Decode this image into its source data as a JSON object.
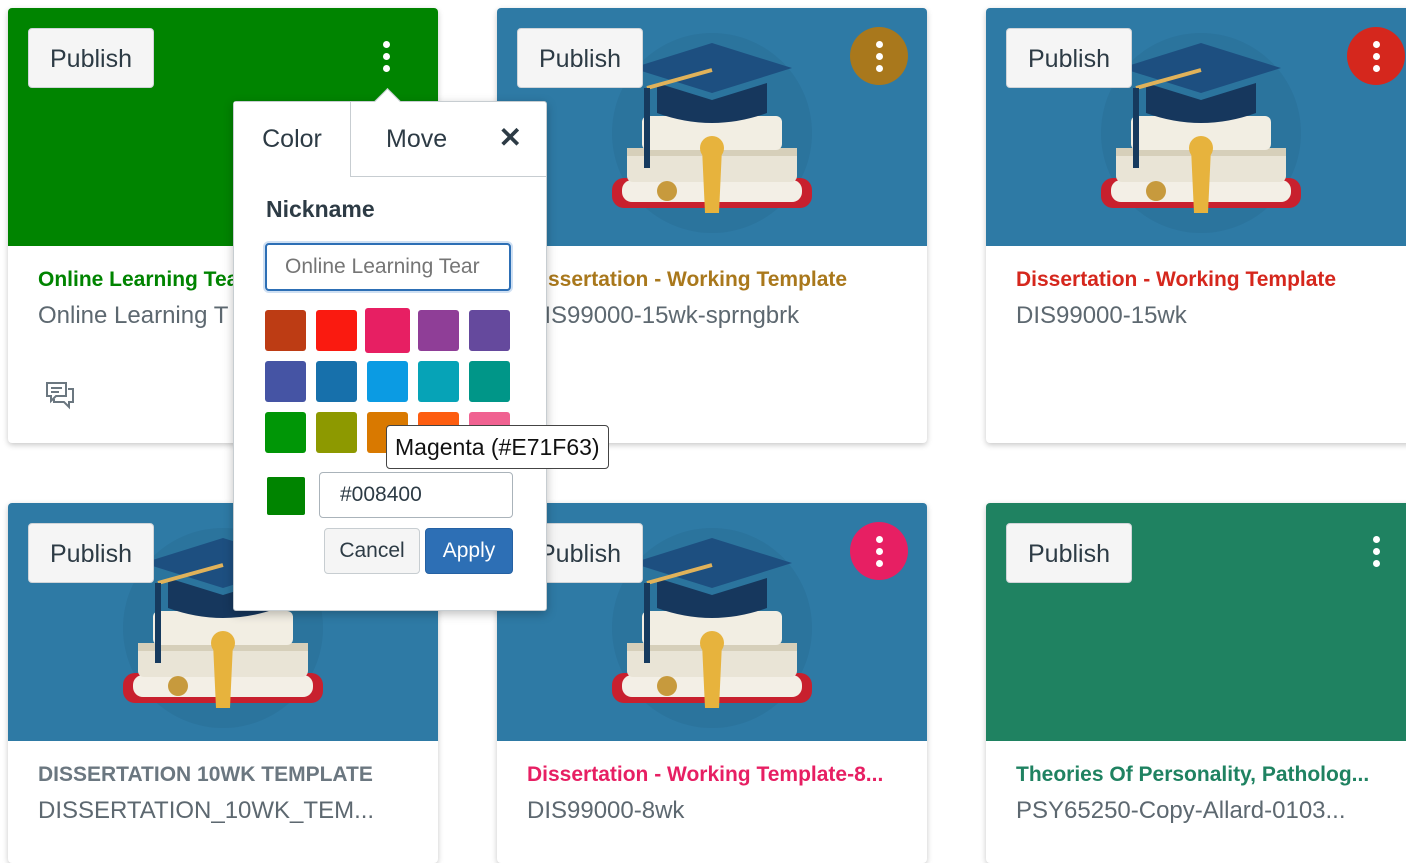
{
  "publish_label": "Publish",
  "colors": {
    "green": "#008400",
    "blue_hero": "#2e7aa5",
    "teal": "#1f8261",
    "gold_kebab": "#a9781c",
    "red_kebab": "#d5271d",
    "magenta_kebab": "#e71f63"
  },
  "cards": [
    {
      "title": "Online Learning Tea",
      "subtitle": "Online Learning T",
      "title_color": "#008400",
      "hero": "solid-green",
      "kebab": "plain",
      "icon": "discussion-icon"
    },
    {
      "title": "Dissertation - Working Template",
      "subtitle": "DIS99000-15wk-sprngbrk",
      "title_color": "#a9781c",
      "hero": "graduation-image",
      "kebab": "gold"
    },
    {
      "title": "Dissertation - Working Template",
      "subtitle": "DIS99000-15wk",
      "title_color": "#d5271d",
      "hero": "graduation-image",
      "kebab": "red"
    },
    {
      "title": "DISSERTATION 10WK TEMPLATE",
      "subtitle": "DISSERTATION_10WK_TEM...",
      "title_color": "#6b7780",
      "hero": "graduation-image",
      "kebab": "none"
    },
    {
      "title": "Dissertation - Working Template-8...",
      "subtitle": "DIS99000-8wk",
      "title_color": "#e71f63",
      "hero": "graduation-image",
      "kebab": "magenta"
    },
    {
      "title": "Theories Of Personality, Patholog...",
      "subtitle": "PSY65250-Copy-Allard-0103...",
      "title_color": "#1f8261",
      "hero": "solid-teal",
      "kebab": "plain"
    }
  ],
  "popover": {
    "tab_color": "Color",
    "tab_move": "Move",
    "close_glyph": "✕",
    "nickname_label": "Nickname",
    "nickname_placeholder": "Online Learning Tear",
    "swatches": [
      "#bd3c14",
      "#fa1a10",
      "#e71f63",
      "#8f3e97",
      "#65499d",
      "#4554a4",
      "#1770ab",
      "#0b9be3",
      "#06a3b7",
      "#009688",
      "#009606",
      "#8d9900",
      "#d97900",
      "#fd5d10",
      "#f06291"
    ],
    "selected_swatch": "#e71f63",
    "current_color": "#008400",
    "hex_value": "#008400",
    "cancel_label": "Cancel",
    "apply_label": "Apply",
    "tooltip": "Magenta (#E71F63)"
  }
}
